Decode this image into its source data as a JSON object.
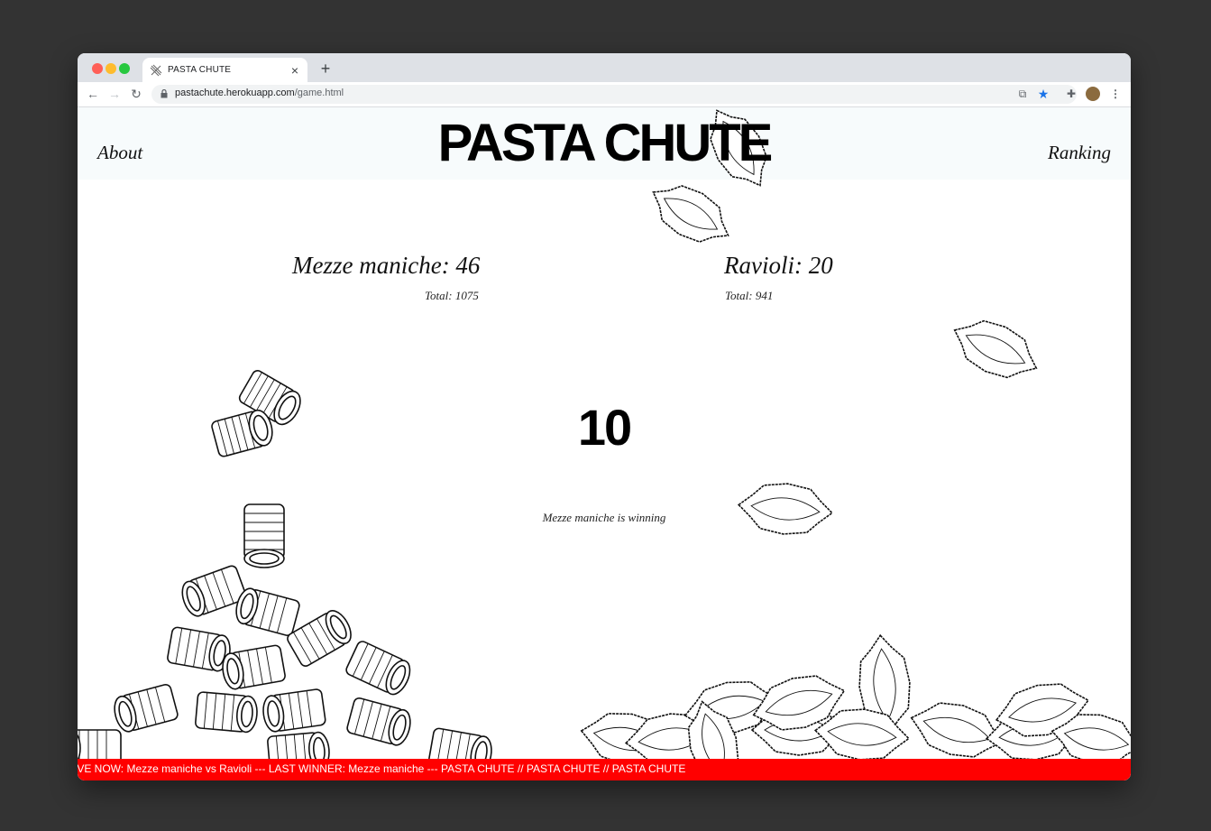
{
  "browser": {
    "tab_title": "PASTA CHUTE",
    "tab_close": "×",
    "new_tab": "+",
    "url_host": "pastachute.herokuapp.com",
    "url_path": "/game.html",
    "icons": [
      "back-icon",
      "forward-icon",
      "reload-icon",
      "lock-icon",
      "translate-icon",
      "star-icon",
      "puzzle-icon",
      "avatar",
      "menu-icon"
    ]
  },
  "header": {
    "about": "About",
    "title": "PASTA CHUTE",
    "ranking": "Ranking"
  },
  "left": {
    "label": "Mezze maniche: 46",
    "total": "Total: 1075"
  },
  "right": {
    "label": "Ravioli: 20",
    "total": "Total: 941"
  },
  "center": {
    "countdown": "10",
    "status": "Mezze maniche is winning"
  },
  "ticker": {
    "text": "IVE NOW: Mezze maniche vs Ravioli --- LAST WINNER: Mezze maniche --- PASTA CHUTE // PASTA CHUTE // PASTA CHUTE"
  },
  "colors": {
    "ticker_bg": "#ff0000",
    "page_bg": "#333333",
    "header_bg": "#f7fbfc"
  }
}
